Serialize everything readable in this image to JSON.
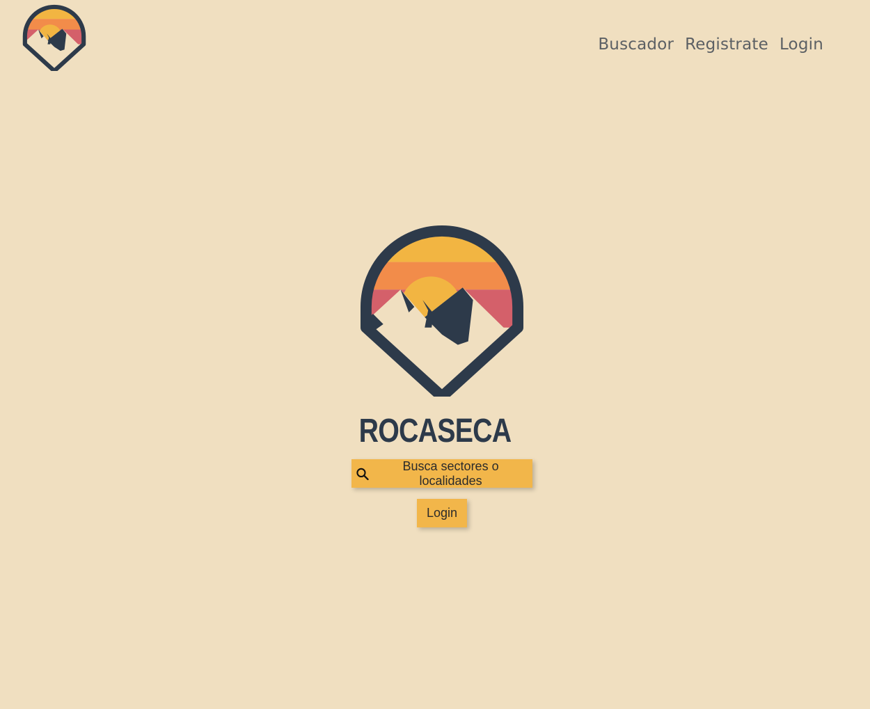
{
  "nav": {
    "items": [
      {
        "label": "Buscador"
      },
      {
        "label": "Registrate"
      },
      {
        "label": "Login"
      }
    ]
  },
  "hero": {
    "brand": "ROCASECA",
    "search_button_label": "Busca sectores o localidades",
    "search_icon": "search-icon",
    "login_button_label": "Login"
  },
  "colors": {
    "background": "#f0dfc0",
    "accent": "#f2b64a",
    "dark": "#2d3a4a",
    "sun_yellow": "#f2b542",
    "sun_orange": "#f28c4a",
    "sun_red": "#d4606a"
  }
}
